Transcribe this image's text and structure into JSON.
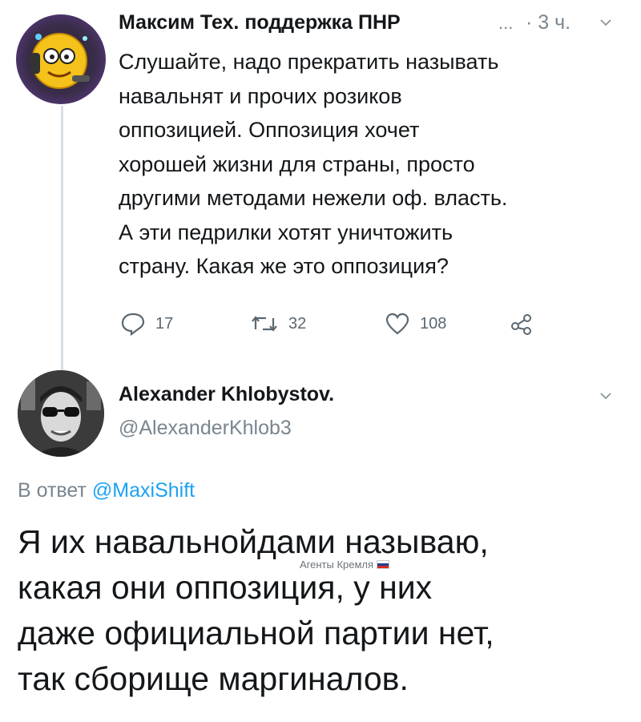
{
  "tweet1": {
    "author": "Максим Тех. поддержка ПНР",
    "truncation": "...",
    "time": "· 3 ч.",
    "lines": [
      "Слушайте, надо прекратить называть",
      "навальнят и прочих розиков",
      "оппозицией. Оппозиция хочет",
      "хорошей жизни для страны, просто",
      "другими методами нежели оф. власть.",
      "А эти педрилки хотят уничтожить",
      "страну. Какая же это оппозиция?"
    ],
    "actions": {
      "replies": "17",
      "retweets": "32",
      "likes": "108"
    }
  },
  "tweet2": {
    "author": "Alexander Khlobystov.",
    "handle": "@AlexanderKhlob3",
    "reply_prefix": "В ответ",
    "reply_to": "@MaxiShift",
    "lines": [
      "Я их навальнойдами называю,",
      "какая они оппозиция, у них",
      "даже официальной партии нет,",
      "так сборище маргиналов."
    ]
  },
  "watermark": "Агенты Кремля",
  "icons": {
    "avatar1": "emoji-smiley-with-phone-avatar",
    "avatar2": "man-with-sunglasses-avatar",
    "chevron": "chevron-down-icon",
    "reply": "reply-bubble-icon",
    "retweet": "retweet-icon",
    "like": "heart-icon",
    "share": "share-icon"
  },
  "colors": {
    "link": "#1da1f2",
    "secondary_text": "#7a868f",
    "thread_line": "#d7dee3"
  }
}
